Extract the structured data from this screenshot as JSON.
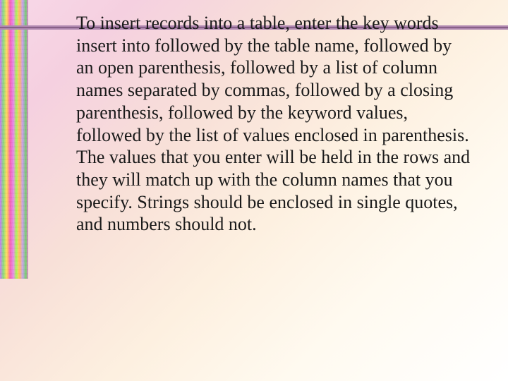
{
  "slide": {
    "body": "To insert records into a table, enter the key words insert into followed by the table name, followed by an open parenthesis, followed by a list of column names separated by commas, followed by a closing parenthesis, followed by the keyword values, followed by the list of values enclosed in parenthesis. The values that you enter will be held in the rows and they will match up with the column names that you specify. Strings should be enclosed in single quotes, and numbers should not."
  }
}
